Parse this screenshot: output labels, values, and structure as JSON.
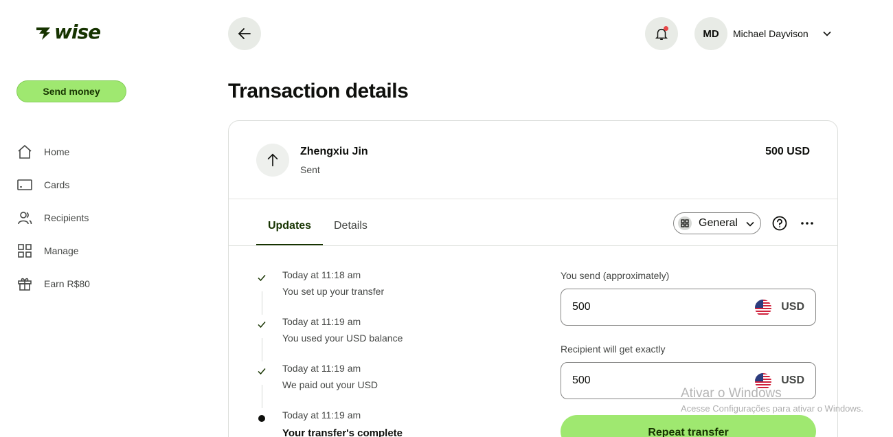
{
  "brand": {
    "name": "wise"
  },
  "sidebar": {
    "send_money": "Send money",
    "items": [
      {
        "label": "Home",
        "icon": "home-icon"
      },
      {
        "label": "Cards",
        "icon": "card-icon"
      },
      {
        "label": "Recipients",
        "icon": "recipients-icon"
      },
      {
        "label": "Manage",
        "icon": "grid-icon"
      },
      {
        "label": "Earn R$80",
        "icon": "gift-icon"
      }
    ]
  },
  "header": {
    "avatar_initials": "MD",
    "user_name": "Michael Dayvison",
    "has_notification": true
  },
  "page": {
    "title": "Transaction details"
  },
  "transaction": {
    "recipient": "Zhengxiu Jin",
    "status": "Sent",
    "amount": "500 USD"
  },
  "tabs": {
    "updates": "Updates",
    "details": "Details",
    "view_select": "General"
  },
  "timeline": [
    {
      "time": "Today at 11:18 am",
      "text": "You set up your transfer",
      "state": "done"
    },
    {
      "time": "Today at 11:19 am",
      "text": "You used your USD balance",
      "state": "done"
    },
    {
      "time": "Today at 11:19 am",
      "text": "We paid out your USD",
      "state": "done"
    },
    {
      "time": "Today at 11:19 am",
      "text": "Your transfer's complete",
      "state": "current"
    }
  ],
  "calculator": {
    "send_label": "You send (approximately)",
    "send_value": "500",
    "send_currency": "USD",
    "receive_label": "Recipient will get exactly",
    "receive_value": "500",
    "receive_currency": "USD",
    "repeat_label": "Repeat transfer"
  },
  "watermark": {
    "title": "Ativar o Windows",
    "subtitle": "Acesse Configurações para ativar o Windows."
  },
  "colors": {
    "brand_green": "#9fe870",
    "forest": "#163300",
    "notification": "#e74848"
  }
}
